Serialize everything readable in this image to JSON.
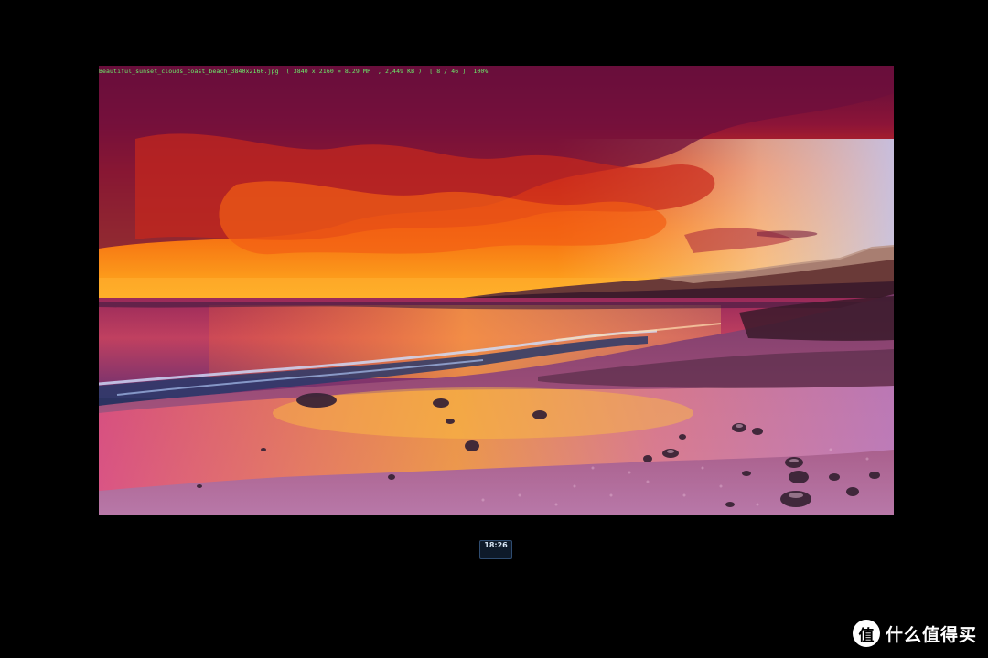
{
  "viewer": {
    "filename": "Beautiful_sunset_clouds_coast_beach_3840x2160.jpg",
    "dimensions": "( 3840 x 2160 = 8.29 MP",
    "filesize": ", 2,449 KB )",
    "index": "[ 8 / 46 ]",
    "zoom": "100%"
  },
  "clock": {
    "top_label": "",
    "time": "18:26"
  },
  "watermark": {
    "logo_glyph": "值",
    "text": "什么值得买"
  },
  "colors": {
    "info_text": "#6cf06c",
    "background": "#000000"
  },
  "image": {
    "subject": "sunset over coastal beach with pebbles and red-orange clouds"
  }
}
